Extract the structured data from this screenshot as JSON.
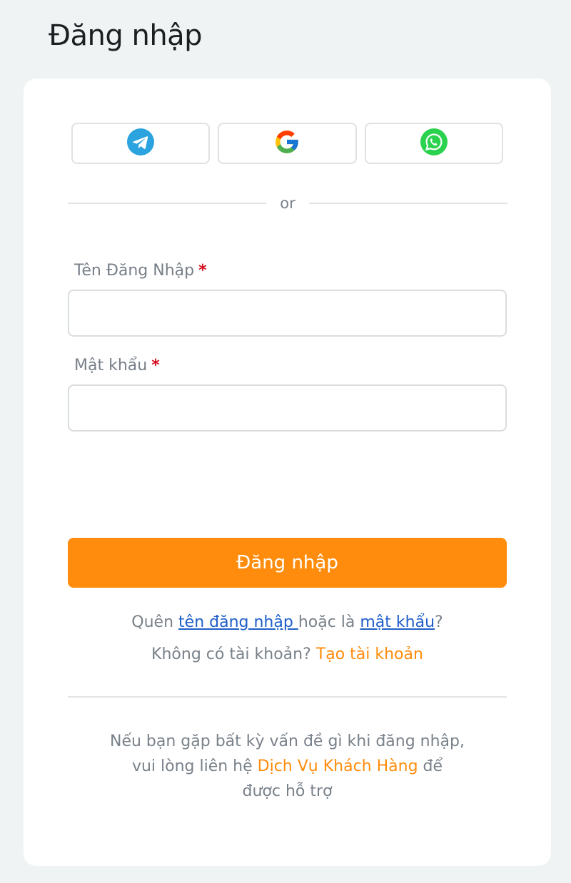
{
  "header": {
    "title": "Đăng nhập"
  },
  "social": {
    "buttons": [
      {
        "name": "telegram",
        "icon": "telegram-icon",
        "color": "#2aa3df"
      },
      {
        "name": "google",
        "icon": "google-icon"
      },
      {
        "name": "whatsapp",
        "icon": "whatsapp-icon",
        "color": "#2bd24e"
      }
    ],
    "divider_text": "or"
  },
  "form": {
    "username": {
      "label": "Tên Đăng Nhập",
      "required_mark": "*",
      "value": "",
      "placeholder": ""
    },
    "password": {
      "label": "Mật khẩu",
      "required_mark": "*",
      "value": "",
      "placeholder": ""
    },
    "submit_label": "Đăng nhập"
  },
  "help": {
    "forgot_prefix": "Quên ",
    "forgot_username_link": "tên đăng nhập ",
    "forgot_middle": "hoặc là ",
    "forgot_password_link": "mật khẩu",
    "forgot_suffix": "?",
    "no_account_text": "Không có tài khoản? ",
    "create_account_link": "Tạo tài khoản"
  },
  "support": {
    "line1": "Nếu bạn gặp bất kỳ vấn đề gì khi đăng nhập,",
    "line2_prefix": "vui lòng liên hệ ",
    "line2_link": "Dịch Vụ Khách Hàng",
    "line2_suffix": " để",
    "line3": "được hỗ trợ"
  },
  "colors": {
    "accent": "#ff8c0c",
    "link": "#1f5fc8",
    "required": "#d20f1f",
    "background": "#f0f3f4"
  }
}
